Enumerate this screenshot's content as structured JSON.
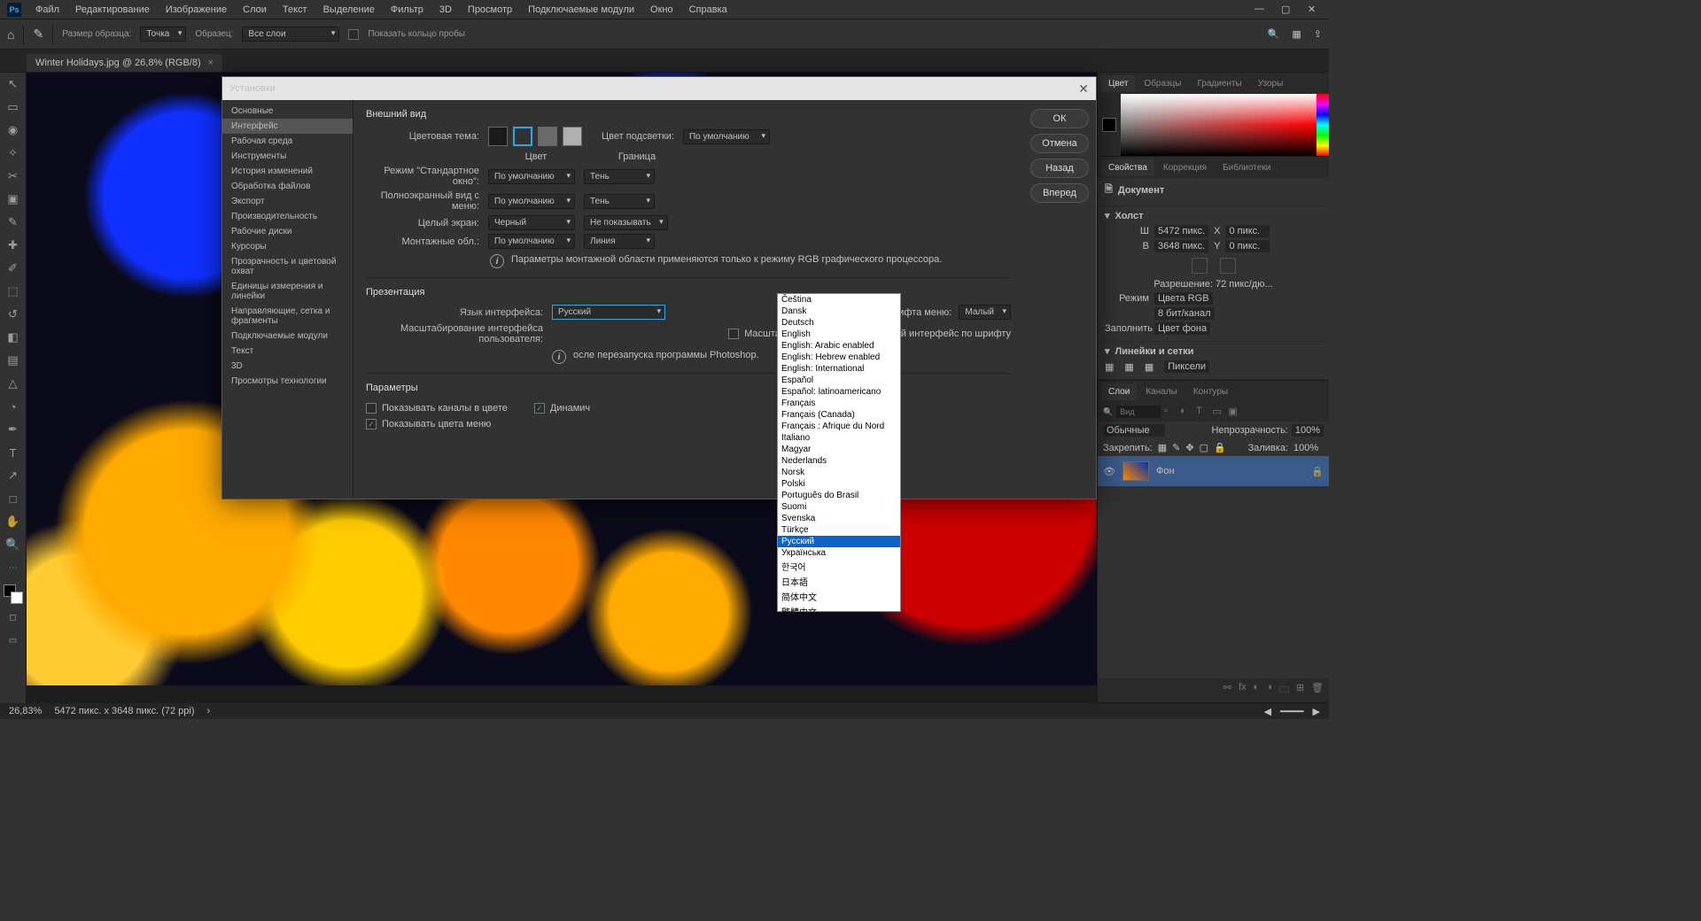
{
  "menu": {
    "items": [
      "Файл",
      "Редактирование",
      "Изображение",
      "Слои",
      "Текст",
      "Выделение",
      "Фильтр",
      "3D",
      "Просмотр",
      "Подключаемые модули",
      "Окно",
      "Справка"
    ]
  },
  "optbar": {
    "brushSize": "Размер образца:",
    "brushSizeVal": "Точка",
    "sample": "Образец:",
    "sampleVal": "Все слои",
    "ring": "Показать кольцо пробы"
  },
  "tab": {
    "title": "Winter Holidays.jpg @ 26,8% (RGB/8)"
  },
  "panels": {
    "color": {
      "tabs": [
        "Цвет",
        "Образцы",
        "Градиенты",
        "Узоры"
      ]
    },
    "props": {
      "tabs": [
        "Свойства",
        "Коррекция",
        "Библиотеки"
      ],
      "doc": "Документ",
      "canvas": "Холст",
      "w": "Ш",
      "wval": "5472 пикс.",
      "x": "X",
      "xval": "0 пикс.",
      "h": "В",
      "hval": "3648 пикс.",
      "y": "Y",
      "yval": "0 пикс.",
      "res": "Разрешение: 72 пикс/дю...",
      "mode": "Режим",
      "modeval": "Цвета RGB",
      "depth": "8 бит/канал",
      "fill": "Заполнить",
      "fillval": "Цвет фона",
      "rulers": "Линейки и сетки",
      "rulersUnit": "Пиксели"
    },
    "layers": {
      "tabs": [
        "Слои",
        "Каналы",
        "Контуры"
      ],
      "kind": "Вид",
      "blend": "Обычные",
      "opacity": "Непрозрачность:",
      "opval": "100%",
      "lock": "Закрепить:",
      "fillLbl": "Заливка:",
      "fillVal": "100%",
      "layerName": "Фон"
    }
  },
  "status": {
    "zoom": "26,83%",
    "dim": "5472 пикс. x 3648 пикс. (72 ppi)"
  },
  "dialog": {
    "title": "Установки",
    "sidebar": [
      "Основные",
      "Интерфейс",
      "Рабочая среда",
      "Инструменты",
      "История изменений",
      "Обработка файлов",
      "Экспорт",
      "Производительность",
      "Рабочие диски",
      "Курсоры",
      "Прозрачность и цветовой охват",
      "Единицы измерения и линейки",
      "Направляющие, сетка и фрагменты",
      "Подключаемые модули",
      "Текст",
      "3D",
      "Просмотры технологии"
    ],
    "sidebarSel": 1,
    "btns": {
      "ok": "ОК",
      "cancel": "Отмена",
      "back": "Назад",
      "fwd": "Вперед"
    },
    "appearance": {
      "title": "Внешний вид",
      "theme": "Цветовая тема:",
      "highlight": "Цвет подсветки:",
      "highlightVal": "По умолчанию",
      "colHead1": "Цвет",
      "colHead2": "Граница",
      "row1": "Режим \"Стандартное окно\":",
      "row2": "Полноэкранный вид с меню:",
      "row3": "Целый экран:",
      "row4": "Монтажные обл.:",
      "c1": "По умолчанию",
      "b1": "Тень",
      "c2": "По умолчанию",
      "b2": "Тень",
      "c3": "Черный",
      "b3": "Не показывать",
      "c4": "По умолчанию",
      "b4": "Линия",
      "info": "Параметры монтажной области применяются только к режиму RGB графического процессора."
    },
    "presentation": {
      "title": "Презентация",
      "lang": "Язык интерфейса:",
      "langVal": "Русский",
      "scale": "Масштабирование интерфейса пользователя:",
      "fontSize": "Размер шрифта меню:",
      "fontSizeVal": "Малый",
      "scaleChk": "Масштабировать пользовательский интерфейс по шрифту",
      "info": "осле перезапуска программы Photoshop."
    },
    "params": {
      "title": "Параметры",
      "c1": "Показывать каналы в цвете",
      "c2": "Динамич",
      "c3": "Показывать цвета меню"
    },
    "langOptions": [
      "Čeština",
      "Dansk",
      "Deutsch",
      "English",
      "English: Arabic enabled",
      "English: Hebrew enabled",
      "English: International",
      "Español",
      "Español: latinoamericano",
      "Français",
      "Français (Canada)",
      "Français : Afrique du Nord",
      "Italiano",
      "Magyar",
      "Nederlands",
      "Norsk",
      "Polski",
      "Português do Brasil",
      "Suomi",
      "Svenska",
      "Türkçe",
      "Русский",
      "Українська",
      "한국어",
      "日本語",
      "简体中文",
      "繁體中文"
    ],
    "langSel": 21
  }
}
